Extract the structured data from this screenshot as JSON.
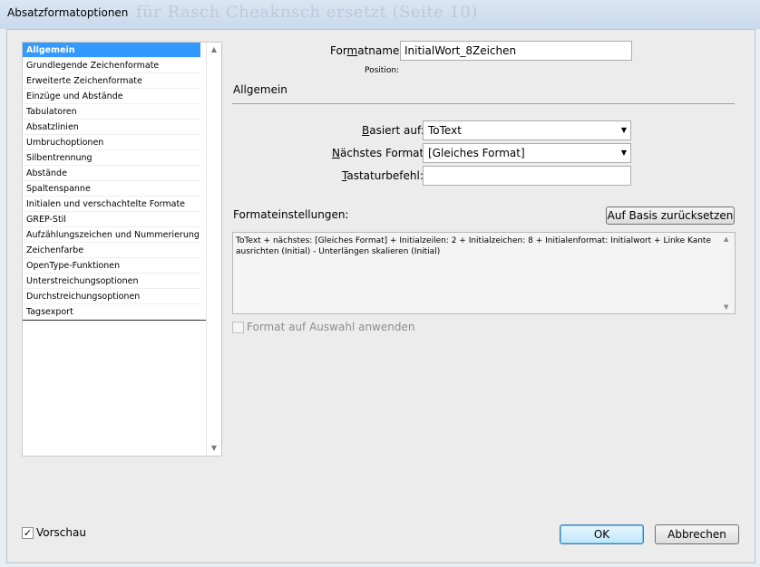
{
  "window": {
    "title": "Absatzformatoptionen",
    "background_text": "für Rasch Cheaknsch ersetzt (Seite 10)"
  },
  "sidebar": {
    "items": [
      {
        "label": "Allgemein",
        "selected": true
      },
      {
        "label": "Grundlegende Zeichenformate"
      },
      {
        "label": "Erweiterte Zeichenformate"
      },
      {
        "label": "Einzüge und Abstände"
      },
      {
        "label": "Tabulatoren"
      },
      {
        "label": "Absatzlinien"
      },
      {
        "label": "Umbruchoptionen"
      },
      {
        "label": "Silbentrennung"
      },
      {
        "label": "Abstände"
      },
      {
        "label": "Spaltenspanne"
      },
      {
        "label": "Initialen und verschachtelte Formate"
      },
      {
        "label": "GREP-Stil"
      },
      {
        "label": "Aufzählungszeichen und Nummerierung"
      },
      {
        "label": "Zeichenfarbe"
      },
      {
        "label": "OpenType-Funktionen"
      },
      {
        "label": "Unterstreichungsoptionen"
      },
      {
        "label": "Durchstreichungsoptionen"
      },
      {
        "label": "Tagsexport"
      }
    ]
  },
  "form": {
    "formatname_label_pre": "For",
    "formatname_label_ul": "m",
    "formatname_label_post": "atname:",
    "formatname_value": "InitialWort_8Zeichen",
    "position_label": "Position:",
    "section_title": "Allgemein",
    "basiert_label_ul": "B",
    "basiert_label_post": "asiert auf:",
    "basiert_value": "ToText",
    "naechstes_label_ul": "N",
    "naechstes_label_post": "ächstes Format:",
    "naechstes_value": "[Gleiches Format]",
    "tastatur_label_ul": "T",
    "tastatur_label_post": "astaturbefehl:",
    "tastatur_value": "",
    "settings_label": "Formateinstellungen:",
    "reset_button": "Auf Basis zurücksetzen",
    "settings_text": "ToText + nächstes: [Gleiches Format] + Initialzeilen:  2 + Initialzeichen:  8 + Initialenformat: Initialwort + Linke Kante ausrichten (Initial) - Unterlängen skalieren (Initial)",
    "apply_checkbox_label": "Format auf Auswahl anwenden",
    "apply_checked": false
  },
  "footer": {
    "preview_label": "Vorschau",
    "preview_checked": true,
    "ok_label": "OK",
    "cancel_label": "Abbrechen"
  },
  "icons": {
    "scroll_up": "▲",
    "scroll_down": "▼",
    "dropdown": "▼",
    "check": "✓"
  }
}
